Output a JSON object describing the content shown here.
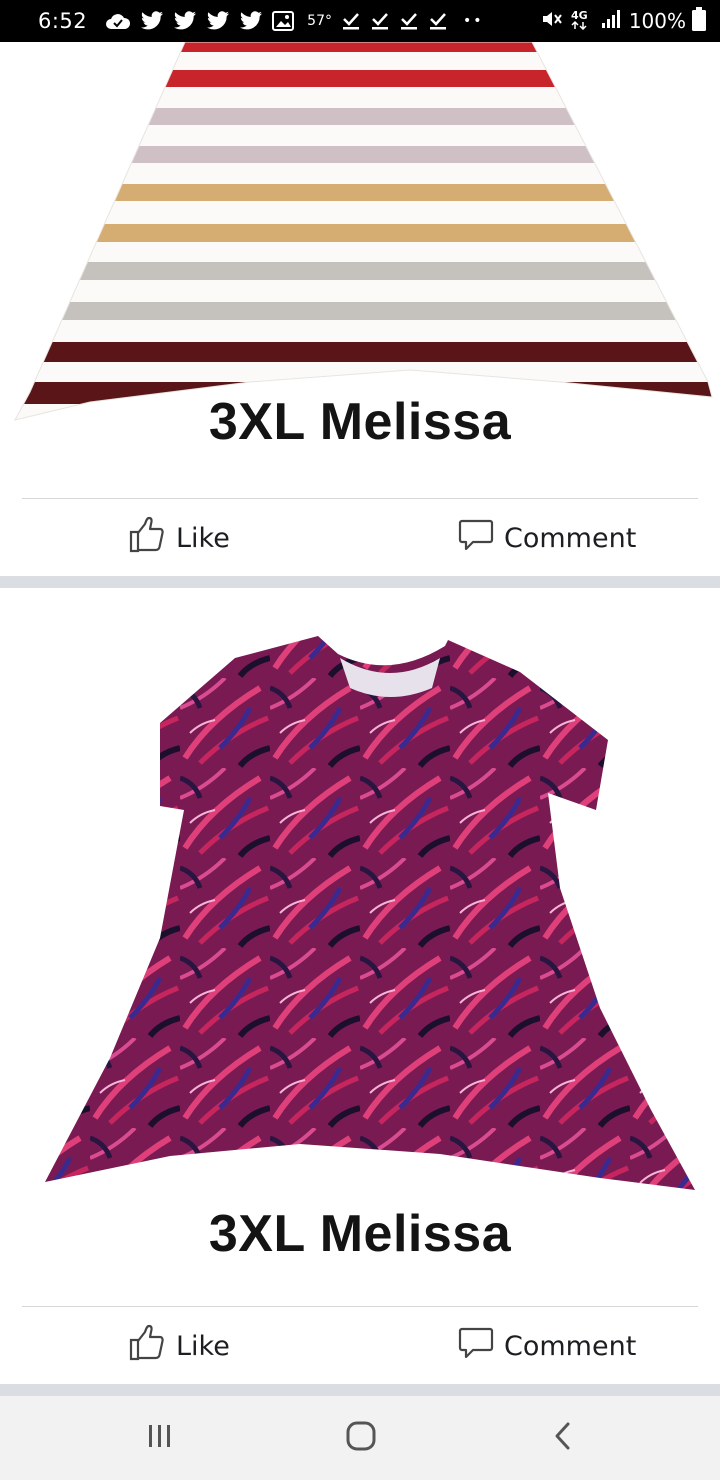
{
  "status_bar": {
    "time": "6:52",
    "temperature": "57°",
    "battery": "100%",
    "network": "4G",
    "icons_left": [
      "cloud-check-icon",
      "twitter-icon",
      "twitter-icon",
      "twitter-icon",
      "twitter-icon",
      "image-icon",
      "download-done-icon",
      "download-done-icon",
      "download-done-icon",
      "download-done-icon"
    ],
    "icons_right": [
      "mute-icon",
      "network-4g-icon",
      "signal-icon",
      "battery-icon"
    ]
  },
  "posts": [
    {
      "caption": "3XL Melissa",
      "photo_subject": "striped-top",
      "like_label": "Like",
      "comment_label": "Comment"
    },
    {
      "caption": "3XL Melissa",
      "photo_subject": "pink-palm-print-top",
      "like_label": "Like",
      "comment_label": "Comment"
    }
  ],
  "colors": {
    "status_bar_bg": "#000000",
    "separator": "#dadde1",
    "nav_bar_bg": "#f2f2f2",
    "stripe_colors": [
      "#c8242b",
      "#cfc0c6",
      "#d5ad72",
      "#c5c1bc",
      "#5a1518"
    ],
    "print_base": "#7a1a52"
  },
  "nav_bar": {
    "buttons": [
      "recents",
      "home",
      "back"
    ]
  }
}
